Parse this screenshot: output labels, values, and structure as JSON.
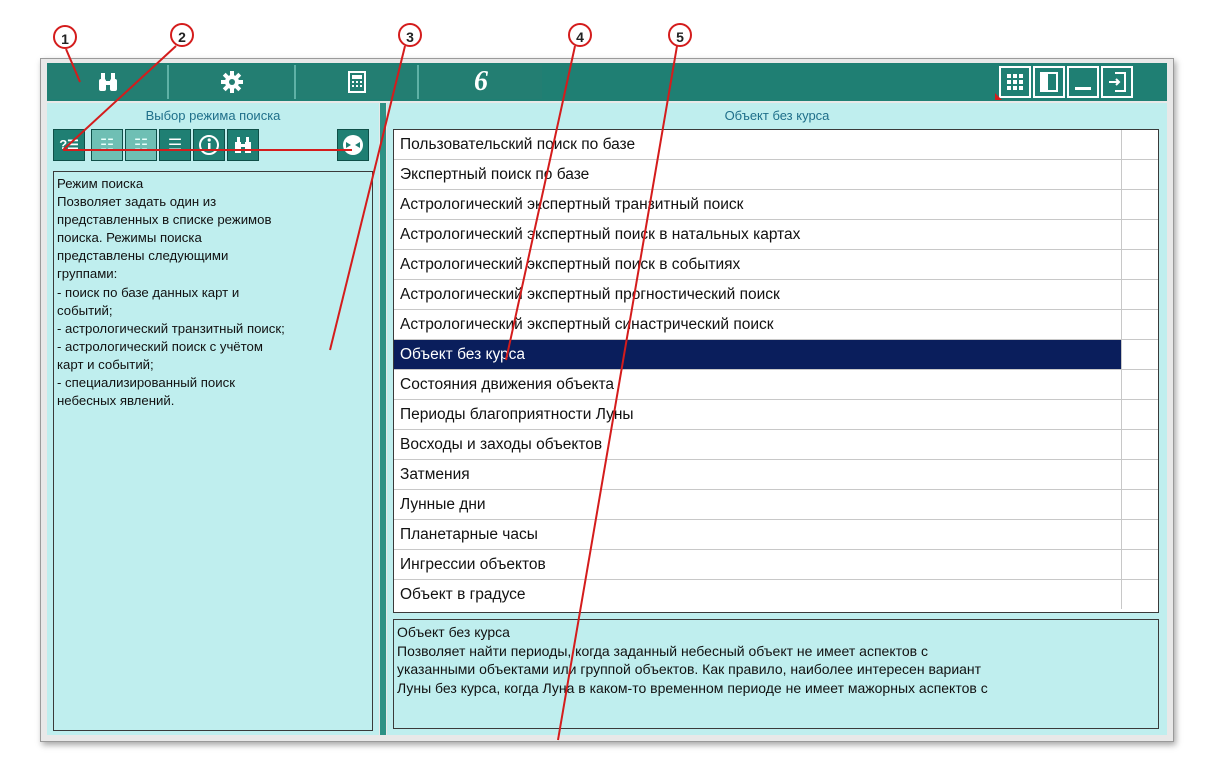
{
  "toolbar": {
    "buttons": [
      {
        "name": "binoculars-icon"
      },
      {
        "name": "gear-icon"
      },
      {
        "name": "calculator-icon"
      },
      {
        "name": "script-6-icon",
        "glyph": "6"
      }
    ],
    "right_buttons": [
      {
        "name": "grid-view-icon"
      },
      {
        "name": "panel-view-icon"
      },
      {
        "name": "minimize-icon"
      },
      {
        "name": "exit-icon"
      }
    ]
  },
  "left_pane": {
    "title": "Выбор режима поиска",
    "mode_icons": [
      {
        "name": "question-list-icon",
        "glyph": "?☰"
      },
      {
        "name": "list-icon-1",
        "glyph": "☷"
      },
      {
        "name": "list-icon-2",
        "glyph": "☷"
      },
      {
        "name": "list-icon-3",
        "glyph": "☰"
      },
      {
        "name": "info-icon",
        "glyph": "ⓘ"
      },
      {
        "name": "binoculars-small-icon",
        "glyph": "⌗"
      },
      {
        "name": "planet-icon",
        "glyph": "◐"
      }
    ],
    "description": [
      "Режим поиска",
      "Позволяет задать один из",
      "представленных в списке режимов",
      "поиска. Режимы поиска",
      "представлены следующими",
      "группами:",
      "- поиск по базе данных карт и",
      "событий;",
      "- астрологический транзитный поиск;",
      "- астрологический поиск с учётом",
      "карт и событий;",
      "- специализированный поиск",
      "небесных явлений."
    ]
  },
  "right_pane": {
    "title": "Объект без курса",
    "items": [
      "Пользовательский поиск по базе",
      "Экспертный поиск по базе",
      "Астрологический экспертный транзитный поиск",
      "Астрологический экспертный поиск в натальных картах",
      "Астрологический экспертный поиск в событиях",
      "Астрологический экспертный прогностический поиск",
      "Астрологический экспертный синастрический поиск",
      "Объект без курса",
      "Состояния движения объекта",
      "Периоды благоприятности Луны",
      "Восходы и заходы объектов",
      "Затмения",
      "Лунные дни",
      "Планетарные часы",
      "Ингрессии объектов",
      "Объект в градусе"
    ],
    "selected_index": 7,
    "footer": [
      "Объект без курса",
      "Позволяет найти периоды, когда заданный небесный объект не имеет аспектов с",
      "указанными объектами или группой объектов. Как правило, наиболее интересен вариант",
      "Луны без курса, когда Луна в каком-то временном периоде не имеет мажорных аспектов с"
    ]
  },
  "callouts": [
    "1",
    "2",
    "3",
    "4",
    "5"
  ],
  "colors": {
    "toolbar": "#1f7f73",
    "pane": "#bfeeee",
    "selection": "#0a1e5c",
    "callout": "#d41c1c"
  }
}
